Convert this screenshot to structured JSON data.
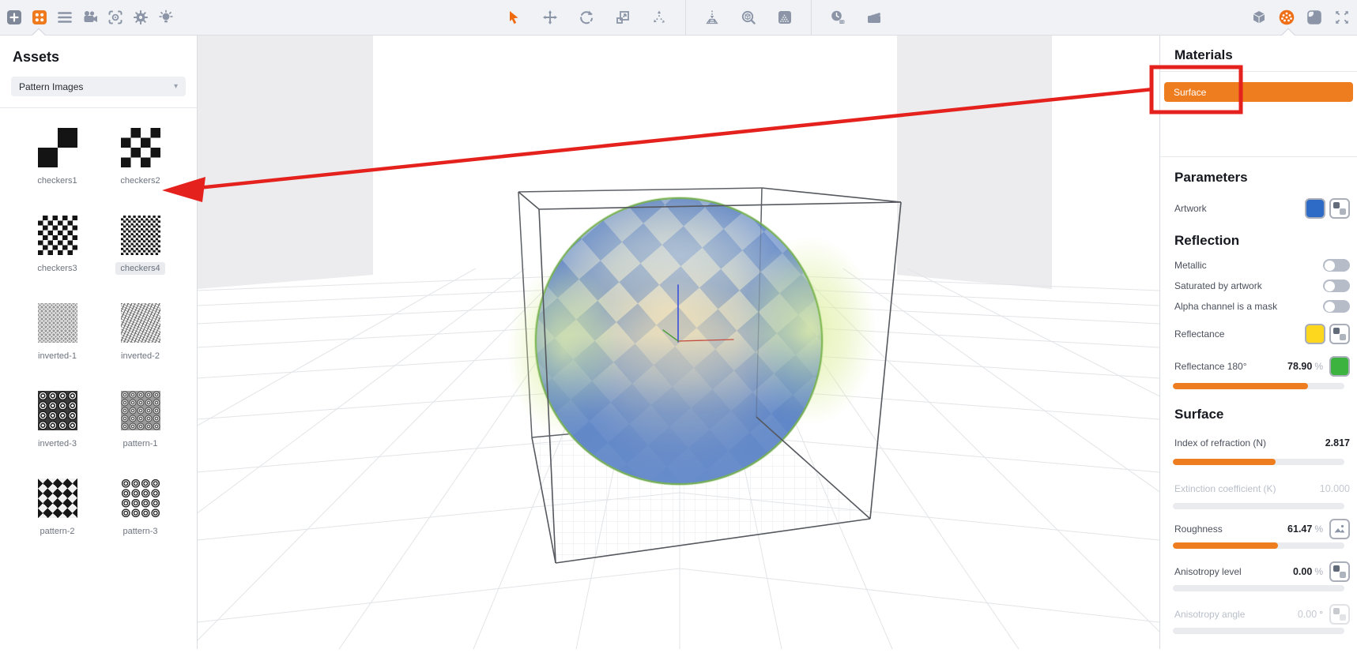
{
  "toolbar": {
    "left_icons": [
      "add",
      "assets",
      "menu",
      "render-camera",
      "capture-frame",
      "settings",
      "light"
    ],
    "center_icons": [
      "select",
      "move",
      "rotate",
      "scale",
      "spread",
      "drop-to-floor",
      "find-view",
      "gradient-environment",
      "history",
      "animation"
    ],
    "right_icons": [
      "scene-objects",
      "materials",
      "backdrop",
      "fullscreen"
    ],
    "active_icons": [
      "assets",
      "select",
      "materials"
    ]
  },
  "assets": {
    "title": "Assets",
    "category": "Pattern Images",
    "items": [
      {
        "label": "checkers1"
      },
      {
        "label": "checkers2"
      },
      {
        "label": "checkers3"
      },
      {
        "label": "checkers4",
        "selected": true
      },
      {
        "label": "inverted-1"
      },
      {
        "label": "inverted-2"
      },
      {
        "label": "inverted-3"
      },
      {
        "label": "pattern-1"
      },
      {
        "label": "pattern-2"
      },
      {
        "label": "pattern-3"
      }
    ]
  },
  "materials": {
    "title": "Materials",
    "items": [
      {
        "name": "Surface",
        "selected": true
      }
    ]
  },
  "parameters": {
    "title": "Parameters",
    "artwork": {
      "label": "Artwork",
      "color": "#2e6bc6"
    }
  },
  "reflection": {
    "title": "Reflection",
    "metallic": {
      "label": "Metallic",
      "on": false
    },
    "saturated": {
      "label": "Saturated by artwork",
      "on": false
    },
    "alpha_mask": {
      "label": "Alpha channel is a mask",
      "on": false
    },
    "reflectance": {
      "label": "Reflectance",
      "color": "#fdd61e"
    },
    "reflectance180": {
      "label": "Reflectance 180°",
      "value": "78.90",
      "unit": "%",
      "color": "#3cb33e",
      "slider_percent": 78.9
    }
  },
  "surface": {
    "title": "Surface",
    "ior": {
      "label": "Index of refraction (N)",
      "value": "2.817",
      "slider_percent": 60,
      "disabled": false
    },
    "extinction": {
      "label": "Extinction coefficient (K)",
      "value": "10.000",
      "slider_percent": 0,
      "disabled": true
    },
    "roughness": {
      "label": "Roughness",
      "value": "61.47",
      "unit": "%",
      "slider_percent": 61.47,
      "disabled": false
    },
    "anisotropy_level": {
      "label": "Anisotropy level",
      "value": "0.00",
      "unit": "%",
      "slider_percent": 0,
      "disabled": false
    },
    "anisotropy_angle": {
      "label": "Anisotropy angle",
      "value": "0.00",
      "unit": "°",
      "slider_percent": 0,
      "disabled": true
    }
  },
  "annotation": {
    "color": "#e4211c"
  }
}
